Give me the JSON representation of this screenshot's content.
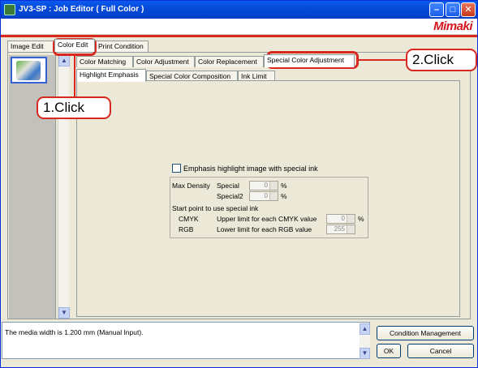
{
  "window": {
    "title": "JV3-SP : Job Editor ( Full Color )",
    "buttons": {
      "minimize": "–",
      "maximize": "□",
      "close": "✕"
    },
    "logo": "Mimaki"
  },
  "tabs_top": [
    "Image Edit",
    "Color Edit",
    "Print Condition"
  ],
  "tabs_color": [
    "Color Matching",
    "Color Adjustment",
    "Color Replacement",
    "Special Color Adjustment"
  ],
  "tabs_special": [
    "Highlight Emphasis",
    "Special Color Composition",
    "Ink Limit"
  ],
  "highlight": {
    "checkbox_label": "Emphasis highlight image with special ink",
    "max_density_label": "Max Density",
    "special_label": "Special",
    "special_value": "0",
    "special2_label": "Special2",
    "special2_value": "0",
    "percent": "%",
    "start_point_label": "Start point to use special ink",
    "cmyk_label": "CMYK",
    "cmyk_desc": "Upper limit for each CMYK value",
    "cmyk_value": "0",
    "rgb_label": "RGB",
    "rgb_desc": "Lower limit for each RGB value",
    "rgb_value": "255"
  },
  "status": {
    "text": "The media width is 1.200 mm (Manual Input).",
    "condition_button": "Condition Management",
    "ok_button": "OK",
    "cancel_button": "Cancel"
  },
  "callouts": {
    "first": "1.Click",
    "second": "2.Click"
  },
  "colors": {
    "accent_red": "#d9281f",
    "title_blue": "#0548d6"
  }
}
